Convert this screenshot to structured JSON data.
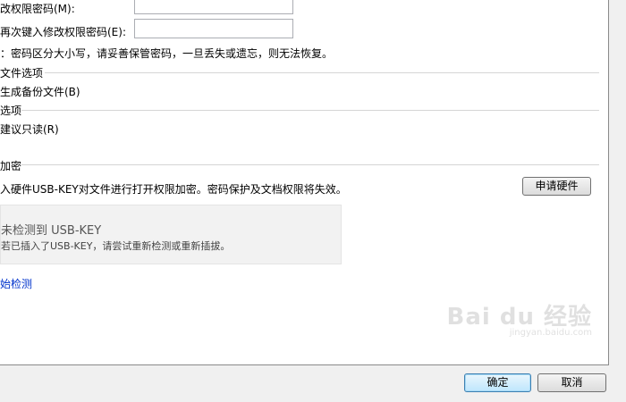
{
  "password": {
    "label": "改权限密码(M):",
    "confirm_label": "再次键入修改权限密码(E):",
    "value": "",
    "confirm_value": "",
    "note": "：密码区分大小写，请妥善保管密码，一旦丢失或遗忘，则无法恢复。"
  },
  "file_options": {
    "title": "文件选项",
    "backup_label": "生成备份文件(B)"
  },
  "options": {
    "title": "选项",
    "readonly_label": "建议只读(R)"
  },
  "encrypt": {
    "title": "加密",
    "desc": "入硬件USB-KEY对文件进行打开权限加密。密码保护及文档权限将失效。",
    "apply_button": "申请硬件",
    "usb_title": "未检测到 USB-KEY",
    "usb_sub": "若已插入了USB-KEY，请尝试重新检测或重新插拔。",
    "start_link": "始检测"
  },
  "footer": {
    "ok": "确定",
    "cancel": "取消"
  },
  "watermark": {
    "brand": "Bai du 经验",
    "url": "jingyan.baidu.com"
  },
  "colors": {
    "link": "#0033cc",
    "default_button_border": "#3c7fb1"
  }
}
